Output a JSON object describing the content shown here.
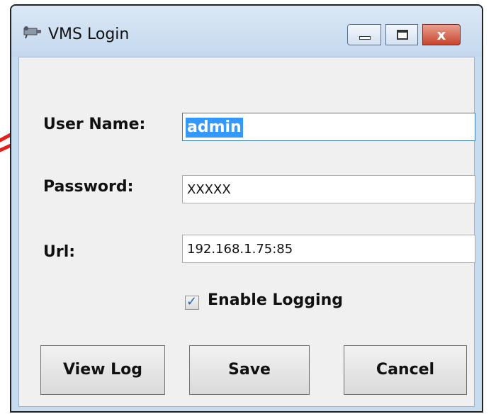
{
  "window": {
    "title": "VMS Login",
    "icon": "camera-icon"
  },
  "caption_buttons": {
    "minimize": "minimize-icon",
    "maximize": "maximize-icon",
    "close": "close-icon",
    "close_glyph": "x"
  },
  "form": {
    "username_label": "User Name:",
    "username_value": "admin",
    "password_label": "Password:",
    "password_value": "XXXXX",
    "url_label": "Url:",
    "url_value": "192.168.1.75:85",
    "logging_label": "Enable Logging",
    "logging_checked": true,
    "check_glyph": "✓"
  },
  "buttons": {
    "view_log": "View Log",
    "save": "Save",
    "cancel": "Cancel"
  },
  "colors": {
    "selection": "#3399ff",
    "annotation": "#e8201c",
    "close_button": "#c7442c"
  }
}
